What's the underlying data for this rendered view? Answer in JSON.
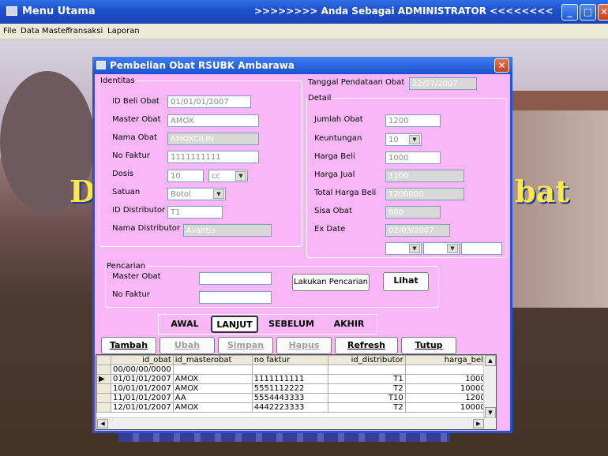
{
  "window": {
    "title": "Menu Utama",
    "banner": ">>>>>>>> Anda Sebagai ADMINISTRATOR <<<<<<<<",
    "minimize": "_",
    "maximize": "□",
    "close": "✕"
  },
  "menu": [
    "File",
    "Data Master",
    "Transaksi",
    "Laporan"
  ],
  "background": {
    "left_letter": "D",
    "right_text": "bat"
  },
  "dialog": {
    "title": "Pembelian Obat RSUBK Ambarawa",
    "close": "✕",
    "identitas": {
      "legend": "Identitas",
      "id_beli_label": "ID Beli Obat",
      "id_beli_value": "01/01/01/2007",
      "master_obat_label": "Master Obat",
      "master_obat_value": "AMOX",
      "nama_obat_label": "Nama Obat",
      "nama_obat_value": "AMOXCILIN",
      "no_faktur_label": "No Faktur",
      "no_faktur_value": "1111111111",
      "dosis_label": "Dosis",
      "dosis_value": "10",
      "dosis_unit": "cc",
      "satuan_label": "Satuan",
      "satuan_value": "Botol",
      "id_distributor_label": "ID Distributor",
      "id_distributor_value": "T1",
      "nama_distributor_label": "Nama Distributor",
      "nama_distributor_value": "Avantis"
    },
    "tanggal_label": "Tanggal Pendataan Obat",
    "tanggal_value": "22/07/2007",
    "detail": {
      "legend": "Detail",
      "jumlah_label": "Jumlah Obat",
      "jumlah_value": "1200",
      "keuntungan_label": "Keuntungan",
      "keuntungan_value": "10",
      "harga_beli_label": "Harga Beli",
      "harga_beli_value": "1000",
      "harga_jual_label": "Harga Jual",
      "harga_jual_value": "1100",
      "total_label": "Total Harga Beli",
      "total_value": "1200000",
      "sisa_label": "Sisa Obat",
      "sisa_value": "860",
      "exdate_label": "Ex Date",
      "exdate_value": "02/03/2007"
    },
    "pencarian": {
      "legend": "Pencarian",
      "master_obat_label": "Master Obat",
      "no_faktur_label": "No Faktur",
      "search_button": "Lakukan Pencarian",
      "lihat_button": "Lihat"
    },
    "nav": {
      "first": "AWAL",
      "next": "LANJUT",
      "prev": "SEBELUM",
      "last": "AKHIR"
    },
    "actions": {
      "tambah": "Tambah",
      "ubah": "Ubah",
      "simpan": "Simpan",
      "hapus": "Hapus",
      "refresh": "Refresh",
      "tutup": "Tutup"
    },
    "grid": {
      "columns": [
        "id_obat",
        "id_masterobat",
        "no faktur",
        "id_distributor",
        "harga_beli"
      ],
      "rows": [
        [
          "00/00/00/0000",
          "",
          "",
          "",
          ""
        ],
        [
          "01/01/01/2007",
          "AMOX",
          "1111111111",
          "T1",
          "1000"
        ],
        [
          "10/01/01/2007",
          "AMOX",
          "5551112222",
          "T2",
          "10000"
        ],
        [
          "11/01/01/2007",
          "AA",
          "5554443333",
          "T10",
          "1200"
        ],
        [
          "12/01/01/2007",
          "AMOX",
          "4442223333",
          "T2",
          "10000"
        ]
      ],
      "current_row": 1
    }
  }
}
